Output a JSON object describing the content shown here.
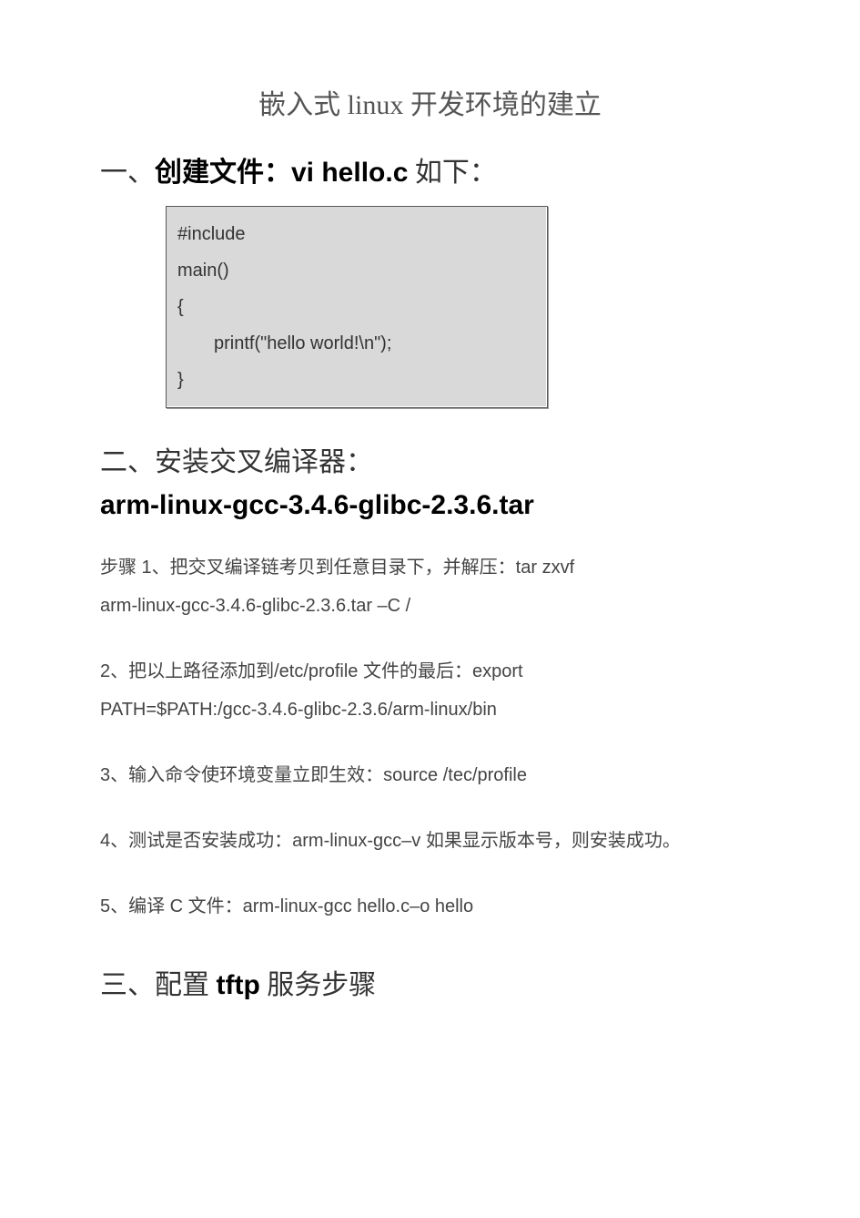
{
  "title": "嵌入式 linux 开发环境的建立",
  "section1": {
    "heading_prefix": "一、",
    "heading_bold": "创建文件：vi  hello.c",
    "heading_suffix": " 如下：",
    "code": {
      "l1": "#include",
      "l2": "main()",
      "l3": "{",
      "l4": "printf(\"hello world!\\n\");",
      "l5": "}"
    }
  },
  "section2": {
    "heading_cn": "二、安装交叉编译器：",
    "heading_file": "arm-linux-gcc-3.4.6-glibc-2.3.6.tar",
    "p1a": "步骤 1、把交叉编译链考贝到任意目录下，并解压：tar zxvf",
    "p1b": "arm-linux-gcc-3.4.6-glibc-2.3.6.tar  –C /",
    "p2a": "2、把以上路径添加到/etc/profile 文件的最后：export",
    "p2b": "PATH=$PATH:/gcc-3.4.6-glibc-2.3.6/arm-linux/bin",
    "p3": "3、输入命令使环境变量立即生效：source  /tec/profile",
    "p4": "4、测试是否安装成功：arm-linux-gcc–v  如果显示版本号，则安装成功。",
    "p5": "5、编译 C 文件：arm-linux-gcc hello.c–o hello"
  },
  "section3": {
    "prefix": "三、配置 ",
    "bold": "tftp",
    "suffix": " 服务步骤"
  }
}
